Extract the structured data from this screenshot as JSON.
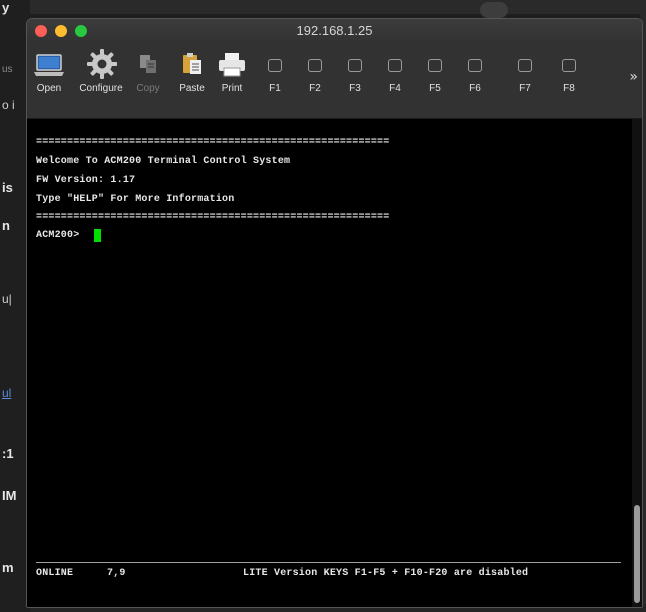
{
  "background_app": {
    "fragments": [
      {
        "text": "y",
        "style": "bold"
      },
      {
        "text": "us",
        "style": ""
      },
      {
        "text": "o i",
        "style": ""
      },
      {
        "text": "is",
        "style": "bold"
      },
      {
        "text": "n",
        "style": "bold"
      },
      {
        "text": "u|",
        "style": ""
      },
      {
        "text": "ul",
        "style": "link"
      },
      {
        "text": ":1",
        "style": "bold"
      },
      {
        "text": "IM",
        "style": "bold"
      },
      {
        "text": "m",
        "style": "bold"
      }
    ]
  },
  "window": {
    "title": "192.168.1.25"
  },
  "toolbar": {
    "open_label": "Open",
    "configure_label": "Configure",
    "copy_label": "Copy",
    "paste_label": "Paste",
    "print_label": "Print",
    "fkeys": [
      "F1",
      "F2",
      "F3",
      "F4",
      "F5",
      "F6",
      "F7",
      "F8"
    ],
    "overflow_label": "»"
  },
  "terminal": {
    "lines": [
      "=========================================================",
      "Welcome To ACM200 Terminal Control System",
      "FW Version: 1.17",
      "Type \"HELP\" For More Information",
      "=========================================================",
      "ACM200>"
    ],
    "status_left": "ONLINE",
    "status_pos": "7,9",
    "status_message": "LITE Version KEYS F1-F5 + F10-F20 are disabled"
  },
  "colors": {
    "cursor": "#00e000",
    "close": "#fe5f57",
    "minimize": "#febc2e",
    "maximize": "#28c840"
  }
}
